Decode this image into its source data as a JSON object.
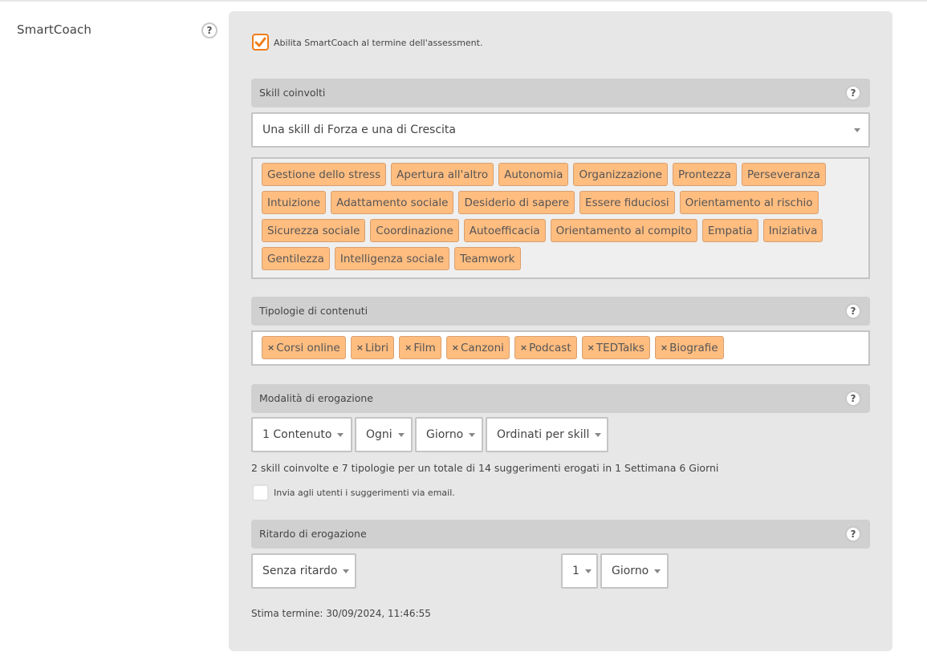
{
  "field": {
    "label": "SmartCoach",
    "help_icon": "question-circle-icon"
  },
  "enable": {
    "checked": true,
    "label": "Abilita SmartCoach al termine dell'assessment.",
    "accent_color": "#f07d1a"
  },
  "skills": {
    "title": "Skill coinvolti",
    "select_value": "Una skill di Forza e una di Crescita",
    "tags": [
      "Gestione dello stress",
      "Apertura all'altro",
      "Autonomia",
      "Organizzazione",
      "Prontezza",
      "Perseveranza",
      "Intuizione",
      "Adattamento sociale",
      "Desiderio di sapere",
      "Essere fiduciosi",
      "Orientamento al rischio",
      "Sicurezza sociale",
      "Coordinazione",
      "Autoefficacia",
      "Orientamento al compito",
      "Empatia",
      "Iniziativa",
      "Gentilezza",
      "Intelligenza sociale",
      "Teamwork"
    ]
  },
  "content_types": {
    "title": "Tipologie di contenuti",
    "remove_glyph": "×",
    "tags": [
      "Corsi online",
      "Libri",
      "Film",
      "Canzoni",
      "Podcast",
      "TEDTalks",
      "Biografie"
    ]
  },
  "delivery": {
    "title": "Modalità di erogazione",
    "quantity": "1 Contenuto",
    "frequency": "Ogni",
    "period": "Giorno",
    "order": "Ordinati per skill",
    "summary": "2 skill coinvolte e 7 tipologie per un totale di 14 suggerimenti erogati in 1 Settimana 6 Giorni",
    "email_checked": false,
    "email_label": "Invia agli utenti i suggerimenti via email."
  },
  "delay": {
    "title": "Ritardo di erogazione",
    "mode": "Senza ritardo",
    "amount": "1",
    "unit": "Giorno",
    "estimate": "Stima termine: 30/09/2024, 11:46:55"
  },
  "colors": {
    "tag_bg": "#ffbd80",
    "panel_bg": "#e7e7e7",
    "section_header_bg": "#d0d0d0"
  }
}
